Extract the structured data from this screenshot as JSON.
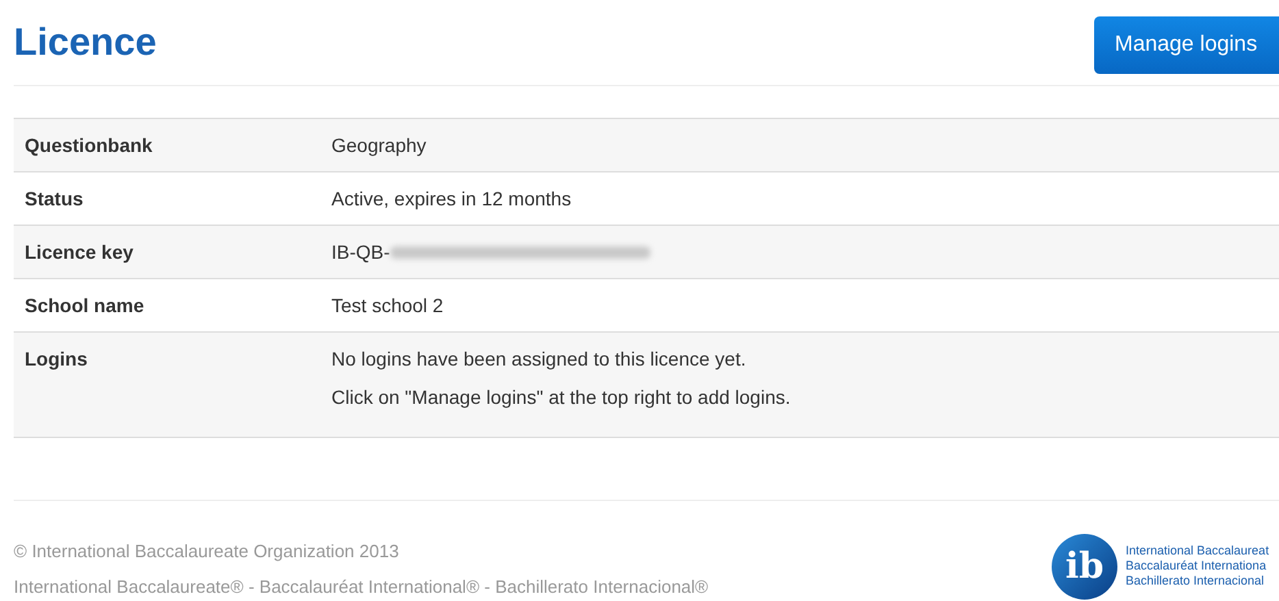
{
  "title": "Licence",
  "manage_button": "Manage logins",
  "rows": [
    {
      "label": "Questionbank",
      "lines": [
        "Geography"
      ]
    },
    {
      "label": "Status",
      "lines": [
        "Active, expires in 12 months"
      ]
    },
    {
      "label": "Licence key",
      "lines": [
        "IB-QB-"
      ],
      "redacted": true
    },
    {
      "label": "School name",
      "lines": [
        "Test school 2"
      ]
    },
    {
      "label": "Logins",
      "lines": [
        "No logins have been assigned to this licence yet.",
        "Click on \"Manage logins\" at the top right to add logins."
      ]
    }
  ],
  "footer": {
    "lines": [
      "© International Baccalaureate Organization 2013",
      "International Baccalaureate® - Baccalauréat International® - Bachillerato Internacional®"
    ],
    "logo": {
      "mark": "ib",
      "lines": [
        "International Baccalaureat",
        "Baccalauréat Internationa",
        "Bachillerato Internacional"
      ]
    }
  }
}
